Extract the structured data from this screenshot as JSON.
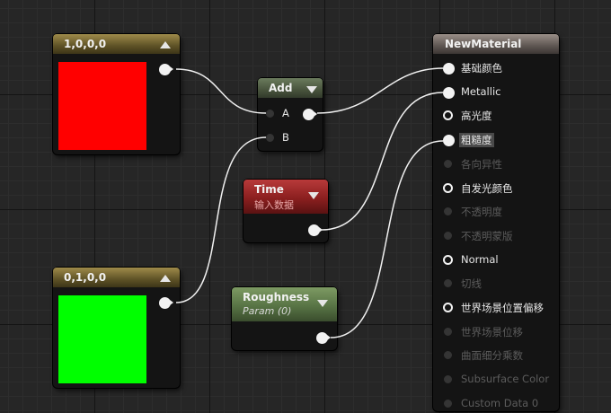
{
  "nodes": {
    "constant_red": {
      "title": "1,0,0,0",
      "color": "#ff0000"
    },
    "constant_green": {
      "title": "0,1,0,0",
      "color": "#00ff00"
    },
    "add": {
      "title": "Add",
      "inputs": [
        "A",
        "B"
      ]
    },
    "time": {
      "title": "Time",
      "subtitle": "输入数据"
    },
    "roughness": {
      "title": "Roughness",
      "subtitle": "Param (0)"
    },
    "material": {
      "title": "NewMaterial",
      "inputs": [
        {
          "label": "基础颜色",
          "state": "connected"
        },
        {
          "label": "Metallic",
          "state": "connected"
        },
        {
          "label": "高光度",
          "state": "enabled"
        },
        {
          "label": "粗糙度",
          "state": "connected-highlight"
        },
        {
          "label": "各向异性",
          "state": "disabled"
        },
        {
          "label": "自发光颜色",
          "state": "enabled"
        },
        {
          "label": "不透明度",
          "state": "disabled"
        },
        {
          "label": "不透明蒙版",
          "state": "disabled"
        },
        {
          "label": "Normal",
          "state": "enabled"
        },
        {
          "label": "切线",
          "state": "disabled"
        },
        {
          "label": "世界场景位置偏移",
          "state": "enabled"
        },
        {
          "label": "世界场景位移",
          "state": "disabled"
        },
        {
          "label": "曲面细分乘数",
          "state": "disabled"
        },
        {
          "label": "Subsurface Color",
          "state": "disabled"
        },
        {
          "label": "Custom Data 0",
          "state": "disabled"
        }
      ]
    }
  }
}
